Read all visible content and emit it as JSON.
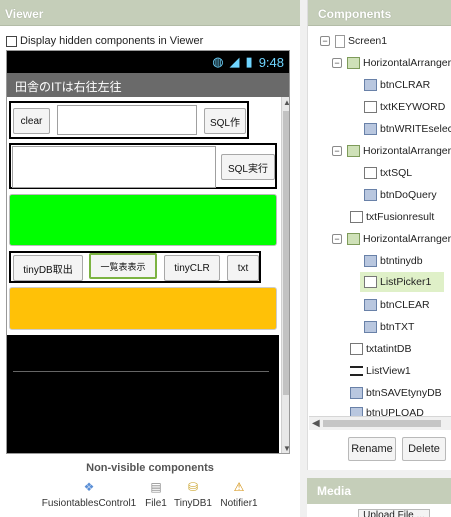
{
  "viewer": {
    "title": "Viewer",
    "hidden_label": "Display hidden components in Viewer",
    "status_time": "9:48",
    "app_title": "田舎のITは右往左往",
    "row1": {
      "clear": "clear",
      "sql_make": "SQL作"
    },
    "row2": {
      "sql_exec": "SQL実行"
    },
    "row3": {
      "tinydb_get": "tinyDB取出",
      "list_show": "一覧表表示",
      "tinyclr": "tinyCLR",
      "txt": "txt"
    },
    "green_color": "#00ff00",
    "amber_color": "#ffc107",
    "nonvisible_title": "Non-visible components",
    "nonvisible": [
      "FusiontablesControl1",
      "File1",
      "TinyDB1",
      "Notifier1"
    ]
  },
  "components": {
    "title": "Components",
    "tree": [
      {
        "label": "Screen1",
        "icon": "screen"
      },
      {
        "label": "HorizontalArranger",
        "icon": "harr"
      },
      {
        "label": "btnCLRAR",
        "icon": "button"
      },
      {
        "label": "txtKEYWORD",
        "icon": "textbox"
      },
      {
        "label": "btnWRITEselect",
        "icon": "button"
      },
      {
        "label": "HorizontalArranger",
        "icon": "harr"
      },
      {
        "label": "txtSQL",
        "icon": "textbox"
      },
      {
        "label": "btnDoQuery",
        "icon": "button"
      },
      {
        "label": "txtFusionresult",
        "icon": "textbox"
      },
      {
        "label": "HorizontalArranger",
        "icon": "harr"
      },
      {
        "label": "btntinydb",
        "icon": "button"
      },
      {
        "label": "ListPicker1",
        "icon": "listpicker"
      },
      {
        "label": "btnCLEAR",
        "icon": "button"
      },
      {
        "label": "btnTXT",
        "icon": "button"
      },
      {
        "label": "txtatintDB",
        "icon": "textbox"
      },
      {
        "label": "ListView1",
        "icon": "listview"
      },
      {
        "label": "btnSAVEtynyDB",
        "icon": "button"
      },
      {
        "label": "btnUPLOAD",
        "icon": "button"
      }
    ],
    "rename": "Rename",
    "delete": "Delete"
  },
  "media": {
    "title": "Media",
    "upload": "Upload File ..."
  }
}
